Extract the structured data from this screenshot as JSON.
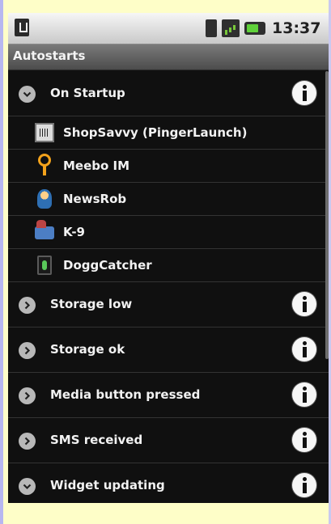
{
  "status": {
    "time": "13:37"
  },
  "title": "Autostarts",
  "groups": [
    {
      "label": "On Startup",
      "expanded": true,
      "apps": [
        {
          "label": "ShopSavvy (PingerLaunch)",
          "icon": "shopsavvy-icon"
        },
        {
          "label": "Meebo IM",
          "icon": "meebo-icon"
        },
        {
          "label": "NewsRob",
          "icon": "newsrob-icon"
        },
        {
          "label": "K-9",
          "icon": "k9-icon"
        },
        {
          "label": "DoggCatcher",
          "icon": "doggcatcher-icon"
        }
      ]
    },
    {
      "label": "Storage low",
      "expanded": false
    },
    {
      "label": "Storage ok",
      "expanded": false
    },
    {
      "label": "Media button pressed",
      "expanded": false
    },
    {
      "label": "SMS received",
      "expanded": false
    },
    {
      "label": "Widget updating",
      "expanded": true
    }
  ],
  "colors": {
    "page_bg": "#fefec8",
    "list_bg": "#101010",
    "text": "#f2f2f2"
  }
}
